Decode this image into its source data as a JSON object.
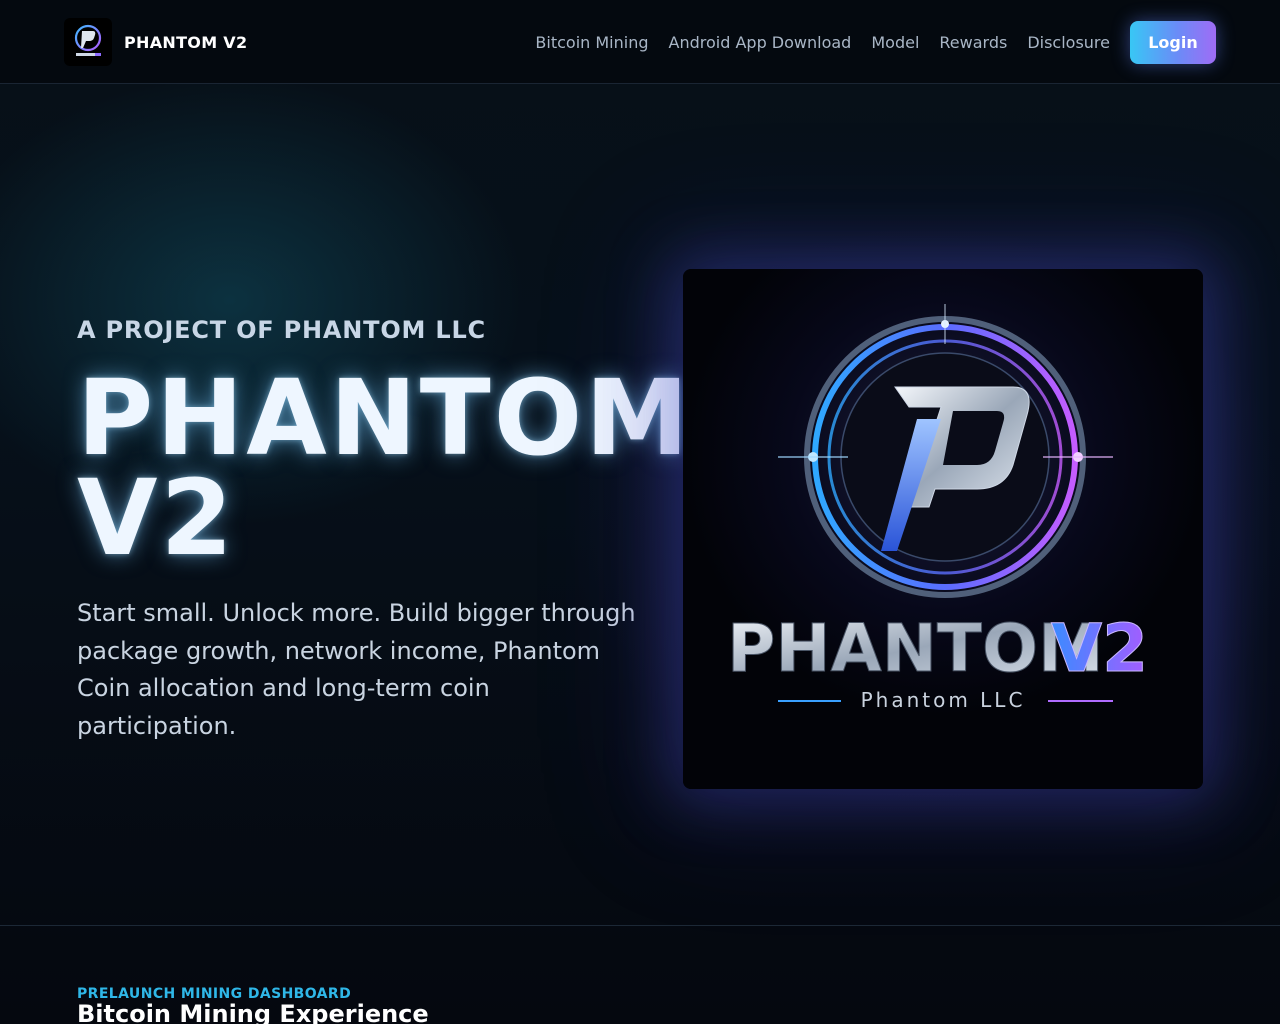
{
  "header": {
    "brand_name": "PHANTOM V2",
    "logo_icon": "phantom-p-logo-icon",
    "nav": [
      {
        "label": "Bitcoin Mining"
      },
      {
        "label": "Android App Download"
      },
      {
        "label": "Model"
      },
      {
        "label": "Rewards"
      },
      {
        "label": "Disclosure"
      }
    ],
    "login_label": "Login"
  },
  "hero": {
    "eyebrow": "A PROJECT OF PHANTOM LLC",
    "title_line1": "PHANTOM",
    "title_line2": "V2",
    "description": "Start small. Unlock more. Build bigger through package growth, network income, Phantom Coin allocation and long-term coin participation.",
    "image": {
      "wordmark_main": "PHANTOM",
      "wordmark_accent": "V2",
      "wordmark_sub": "Phantom LLC"
    }
  },
  "section": {
    "eyebrow": "PRELAUNCH MINING DASHBOARD",
    "title": "Bitcoin Mining Experience"
  },
  "colors": {
    "accent_cyan": "#38c7f5",
    "accent_purple": "#9f6cf6",
    "background": "#05080f"
  }
}
